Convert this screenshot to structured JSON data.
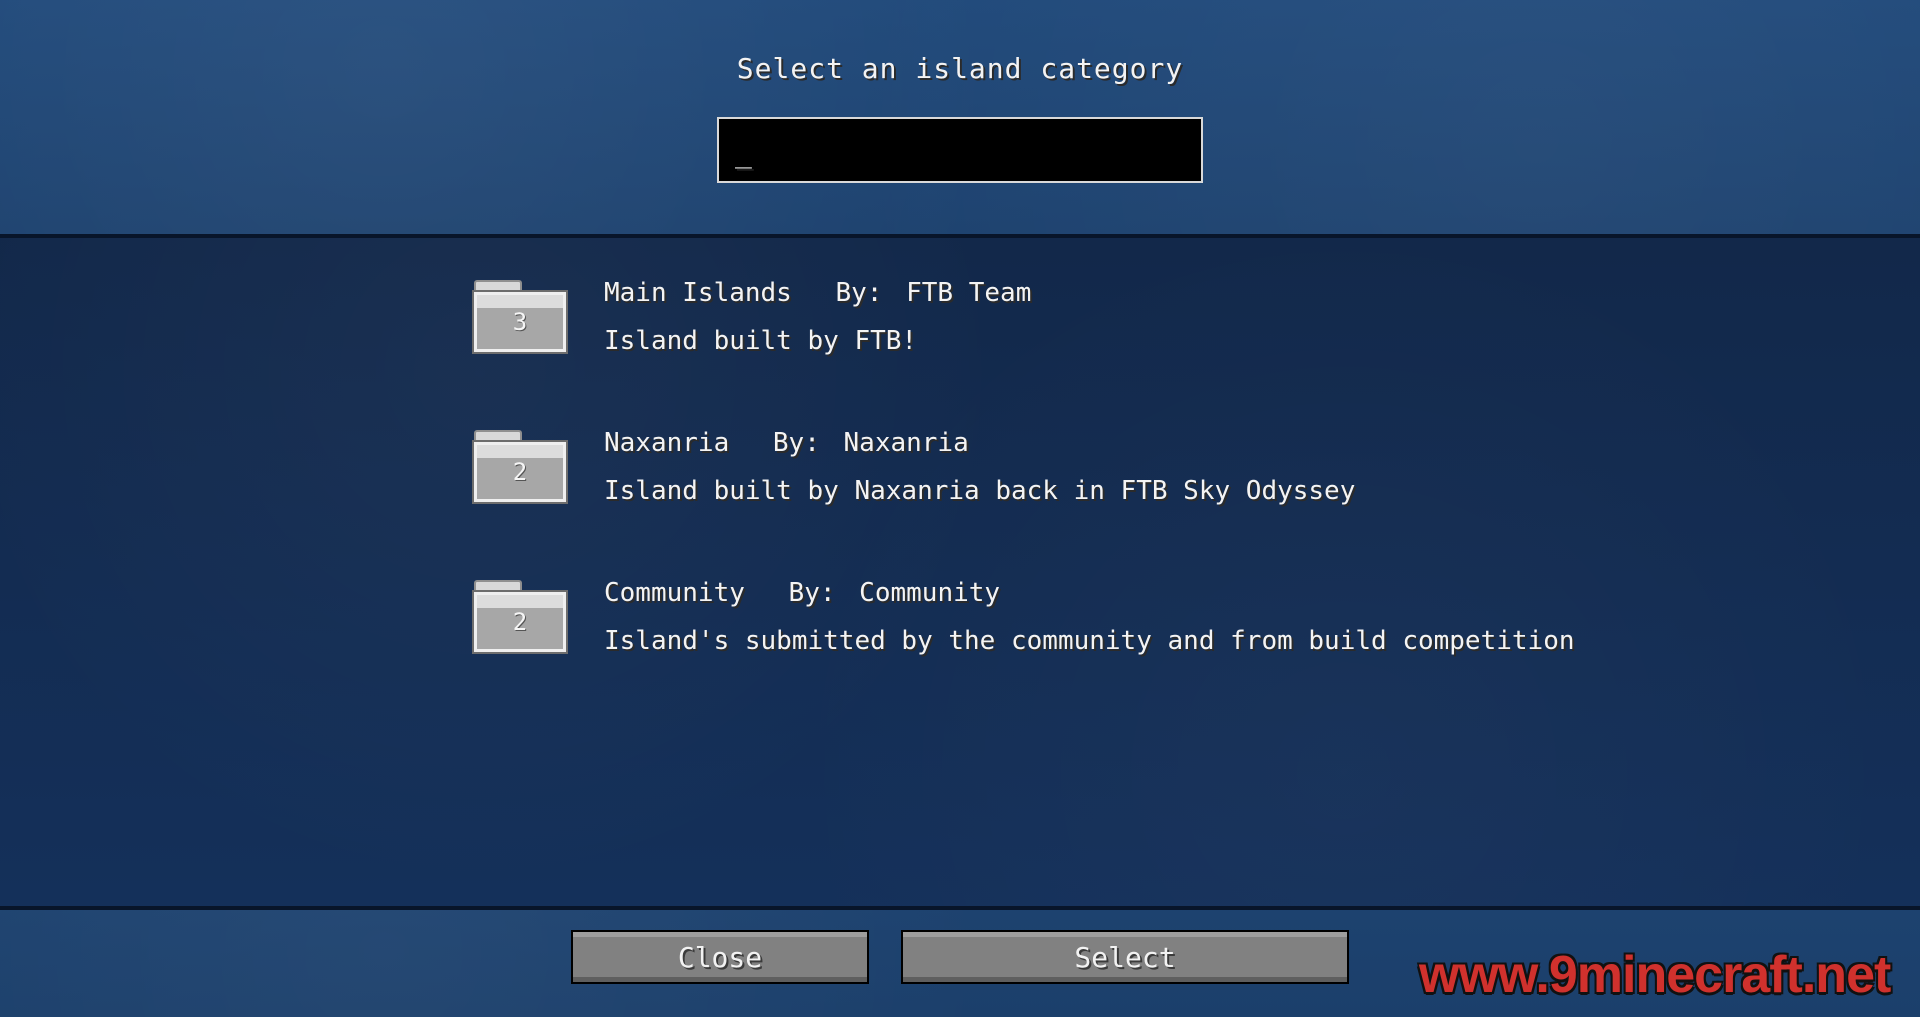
{
  "header": {
    "title": "Select an island category",
    "search": {
      "value": "",
      "placeholder": "",
      "caret": "_"
    }
  },
  "categories": [
    {
      "name": "Main Islands",
      "author_label": "By:",
      "author": "FTB Team",
      "description": "Island built by FTB!",
      "count": "3",
      "icon": "folder-icon"
    },
    {
      "name": "Naxanria",
      "author_label": "By:",
      "author": "Naxanria",
      "description": "Island built by Naxanria back in FTB Sky Odyssey",
      "count": "2",
      "icon": "folder-icon"
    },
    {
      "name": "Community",
      "author_label": "By:",
      "author": "Community",
      "description": "Island's submitted by the community and from build competition",
      "count": "2",
      "icon": "folder-icon"
    }
  ],
  "footer": {
    "close_label": "Close",
    "select_label": "Select"
  },
  "watermark": {
    "text": "www.9minecraft.net"
  },
  "colors": {
    "header_blue": "#214a7b",
    "list_blue": "#12284a",
    "text_white": "#f4f4f4",
    "button_gray": "#818181",
    "watermark_red": "#d0312d"
  }
}
